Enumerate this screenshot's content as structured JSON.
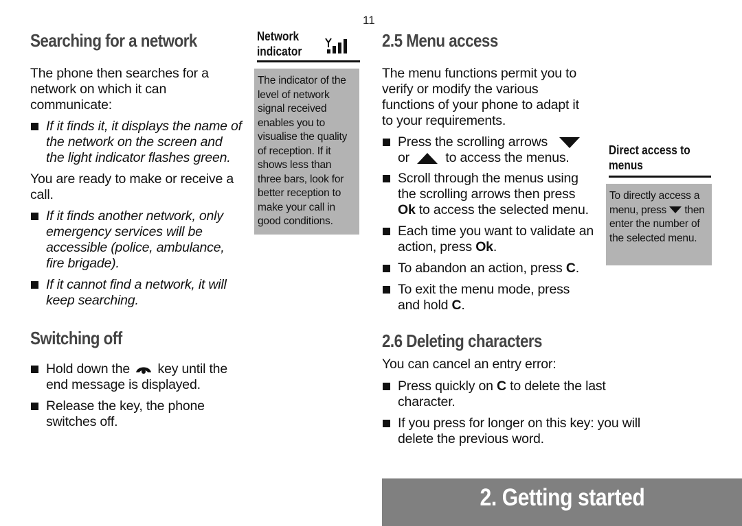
{
  "page_number": "11",
  "left": {
    "searching": {
      "title": "Searching for a network",
      "intro": "The phone then searches for a network on which it can communicate:",
      "bullet1": "If it finds it, it displays the name of the network on the screen and the light indicator flashes green.",
      "ready": "You are ready to make or receive a call.",
      "bullet2": "If it finds another network, only emergency services will be accessible (police, ambulance, fire brigade).",
      "bullet3": "If it cannot find a network, it will keep searching."
    },
    "switching_off": {
      "title": "Switching off",
      "bullet1_before": "Hold down the",
      "bullet1_icon": "end-call-key-icon",
      "bullet1_after": "key until the end message is displayed.",
      "bullet2": "Release the key, the phone switches off."
    }
  },
  "network_sidebar": {
    "title_line1": "Network",
    "title_line2": "indicator",
    "icon": "signal-strength-icon",
    "body": "The indicator of the level of network signal received enables you to visualise the quality of reception. If it shows less than three bars, look for better reception to make your call in good conditions."
  },
  "menu_access": {
    "title": "2.5  Menu access",
    "intro": "The menu functions permit you to verify or modify the various functions of your phone to adapt it to your requirements.",
    "b1_part1": "Press the scrolling arrows",
    "b1_icon_down": "arrow-down-icon",
    "b1_or": "or",
    "b1_icon_up": "arrow-up-icon",
    "b1_part2": "to access the menus.",
    "b2_text": "Scroll through the menus using the scrolling arrows then press",
    "b2_bold": "Ok",
    "b2_after": "to access the selected menu.",
    "b3_text": "Each time you want to validate an action, press",
    "b3_bold": "Ok",
    "b3_after": ".",
    "b4_text": "To abandon an action, press",
    "b4_bold": "C",
    "b4_after": ".",
    "b5_text": "To exit the menu mode, press and hold",
    "b5_bold": "C",
    "b5_after": "."
  },
  "direct_sidebar": {
    "title_line1": "Direct access to",
    "title_line2": "menus",
    "body_before": "To directly access a menu,  press",
    "body_icon": "arrow-down-icon",
    "body_after": "then enter the number of the selected menu."
  },
  "deleting": {
    "title": "2.6  Deleting characters",
    "intro": "You can cancel an entry error:",
    "b1_before": "Press quickly on",
    "b1_bold": "C",
    "b1_after": "to delete the last character.",
    "b2": "If you press for longer on this key: you will delete the previous word."
  },
  "footer": {
    "chapter_title": "2. Getting started",
    "band_color": "#808080"
  }
}
